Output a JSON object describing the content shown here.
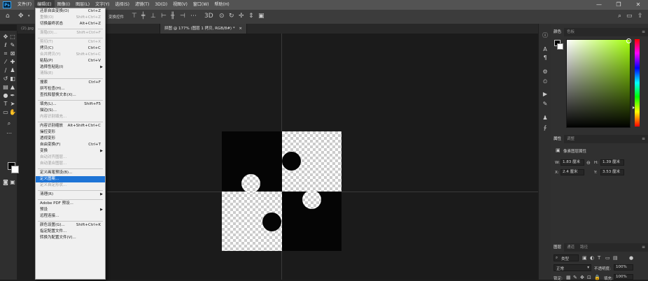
{
  "app": {
    "logo": "Ps",
    "menus": [
      "文件(F)",
      "编辑(E)",
      "图像(I)",
      "图层(L)",
      "文字(Y)",
      "选择(S)",
      "滤镜(T)",
      "3D(D)",
      "视图(V)",
      "窗口(W)",
      "帮助(H)"
    ],
    "active_menu_index": 1,
    "window_controls": [
      "—",
      "❐",
      "✕"
    ]
  },
  "options_bar": {
    "label": "变换控件"
  },
  "tabs": [
    {
      "label": "(2).jpg @ 100%(RGB/8#)",
      "active": false
    },
    {
      "label": "拼图 @ 177% (图层 1 拷贝, RGB/8#) *",
      "active": true
    }
  ],
  "edit_menu": {
    "items": [
      {
        "type": "item",
        "label": "还原自由变换(O)",
        "shortcut": "Ctrl+Z",
        "disabled": false
      },
      {
        "type": "item",
        "label": "重做(O)",
        "shortcut": "Shift+Ctrl+Z",
        "disabled": true
      },
      {
        "type": "item",
        "label": "切换最终状态",
        "shortcut": "Alt+Ctrl+Z",
        "disabled": false
      },
      {
        "type": "separator"
      },
      {
        "type": "item",
        "label": "渐隐(D)...",
        "shortcut": "Shift+Ctrl+F",
        "disabled": true
      },
      {
        "type": "separator"
      },
      {
        "type": "item",
        "label": "剪切(T)",
        "shortcut": "Ctrl+X",
        "disabled": true
      },
      {
        "type": "item",
        "label": "拷贝(C)",
        "shortcut": "Ctrl+C",
        "disabled": false
      },
      {
        "type": "item",
        "label": "合并拷贝(Y)",
        "shortcut": "Shift+Ctrl+C",
        "disabled": true
      },
      {
        "type": "item",
        "label": "粘贴(P)",
        "shortcut": "Ctrl+V",
        "disabled": false
      },
      {
        "type": "item",
        "label": "选择性粘贴(I)",
        "shortcut": "",
        "disabled": false,
        "submenu": true
      },
      {
        "type": "item",
        "label": "清除(E)",
        "shortcut": "",
        "disabled": true
      },
      {
        "type": "separator"
      },
      {
        "type": "item",
        "label": "搜索",
        "shortcut": "Ctrl+F",
        "disabled": false
      },
      {
        "type": "item",
        "label": "拼写检查(H)...",
        "shortcut": "",
        "disabled": false
      },
      {
        "type": "item",
        "label": "查找和替换文本(X)...",
        "shortcut": "",
        "disabled": false
      },
      {
        "type": "separator"
      },
      {
        "type": "item",
        "label": "填充(L)...",
        "shortcut": "Shift+F5",
        "disabled": false
      },
      {
        "type": "item",
        "label": "描边(S)...",
        "shortcut": "",
        "disabled": false
      },
      {
        "type": "item",
        "label": "内容识别填充...",
        "shortcut": "",
        "disabled": true
      },
      {
        "type": "separator"
      },
      {
        "type": "item",
        "label": "内容识别缩放",
        "shortcut": "Alt+Shift+Ctrl+C",
        "disabled": false
      },
      {
        "type": "item",
        "label": "操控变形",
        "shortcut": "",
        "disabled": false
      },
      {
        "type": "item",
        "label": "透视变形",
        "shortcut": "",
        "disabled": false
      },
      {
        "type": "item",
        "label": "自由变换(F)",
        "shortcut": "Ctrl+T",
        "disabled": false
      },
      {
        "type": "item",
        "label": "变换",
        "shortcut": "",
        "disabled": false,
        "submenu": true
      },
      {
        "type": "item",
        "label": "自动对齐图层...",
        "shortcut": "",
        "disabled": true
      },
      {
        "type": "item",
        "label": "自动混合图层...",
        "shortcut": "",
        "disabled": true
      },
      {
        "type": "separator"
      },
      {
        "type": "item",
        "label": "定义画笔预设(B)...",
        "shortcut": "",
        "disabled": false
      },
      {
        "type": "item",
        "label": "定义图案...",
        "shortcut": "",
        "disabled": false,
        "highlighted": true
      },
      {
        "type": "item",
        "label": "定义自定形状...",
        "shortcut": "",
        "disabled": true
      },
      {
        "type": "separator"
      },
      {
        "type": "item",
        "label": "清理(R)",
        "shortcut": "",
        "disabled": false,
        "submenu": true
      },
      {
        "type": "separator"
      },
      {
        "type": "item",
        "label": "Adobe PDF 预设...",
        "shortcut": "",
        "disabled": false
      },
      {
        "type": "item",
        "label": "预设",
        "shortcut": "",
        "disabled": false,
        "submenu": true
      },
      {
        "type": "item",
        "label": "远程连接...",
        "shortcut": "",
        "disabled": false
      },
      {
        "type": "separator"
      },
      {
        "type": "item",
        "label": "颜色设置(G)...",
        "shortcut": "Shift+Ctrl+K",
        "disabled": false
      },
      {
        "type": "item",
        "label": "指定配置文件...",
        "shortcut": "",
        "disabled": false
      },
      {
        "type": "item",
        "label": "转换为配置文件(V)...",
        "shortcut": "",
        "disabled": false
      }
    ]
  },
  "color_panel": {
    "tabs": [
      "颜色",
      "色板"
    ],
    "menu_icon": "≡",
    "gradient_hue": "#a4ff0e",
    "foreground": "#000000",
    "background": "#ffffff"
  },
  "properties_panel": {
    "tabs": [
      "属性",
      "调整"
    ],
    "menu_icon": "≡",
    "layer_type": "像素图层属性",
    "w_label": "W:",
    "w_value": "1.83 厘米",
    "h_label": "H:",
    "h_value": "1.39 厘米",
    "x_label": "X:",
    "x_value": "2.4 厘米",
    "y_label": "Y:",
    "y_value": "3.53 厘米"
  },
  "layers_panel": {
    "tabs": [
      "图层",
      "通道",
      "路径"
    ],
    "menu_icon": "≡",
    "filter_label": "类型",
    "blend_mode": "正常",
    "opacity_label": "不透明度:",
    "opacity_value": "100%",
    "lock_label": "锁定:",
    "fill_label": "填充:",
    "fill_value": "100%"
  }
}
